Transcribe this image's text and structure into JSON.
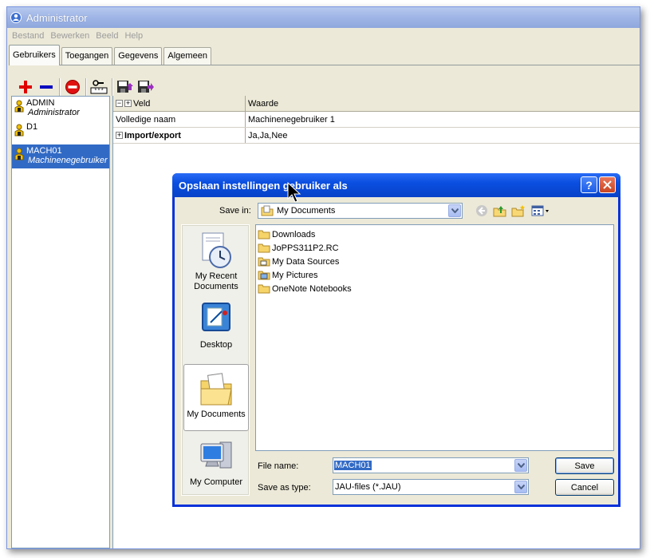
{
  "window": {
    "title": "Administrator"
  },
  "menu": [
    "Bestand",
    "Bewerken",
    "Beeld",
    "Help"
  ],
  "tabs": [
    "Gebruikers",
    "Toegangen",
    "Gegevens",
    "Algemeen"
  ],
  "users": [
    {
      "name": "ADMIN",
      "desc": "Administrator"
    },
    {
      "name": "D1",
      "desc": ""
    },
    {
      "name": "MACH01",
      "desc": "Machinenegebruiker"
    }
  ],
  "grid": {
    "headers": [
      "Veld",
      "Waarde"
    ],
    "rows": [
      {
        "field": "Volledige naam",
        "value": "Machinenegebruiker 1"
      },
      {
        "field": "Import/export",
        "value": "Ja,Ja,Nee"
      }
    ]
  },
  "dialog": {
    "title": "Opslaan instellingen gebruiker als",
    "save_in_label": "Save in:",
    "save_in_value": "My Documents",
    "places": [
      "My Recent Documents",
      "Desktop",
      "My Documents",
      "My Computer"
    ],
    "files": [
      "Downloads",
      "JoPPS311P2.RC",
      "My Data Sources",
      "My Pictures",
      "OneNote Notebooks"
    ],
    "file_name_label": "File name:",
    "file_name_value": "MACH01",
    "save_type_label": "Save as type:",
    "save_type_value": "JAU-files (*.JAU)",
    "save_button": "Save",
    "cancel_button": "Cancel",
    "help_button": "?"
  },
  "colors": {
    "selection": "#316ac5",
    "dialog_title": "#0a4ee0",
    "add_icon": "#e00000",
    "remove_icon": "#0000c0"
  }
}
